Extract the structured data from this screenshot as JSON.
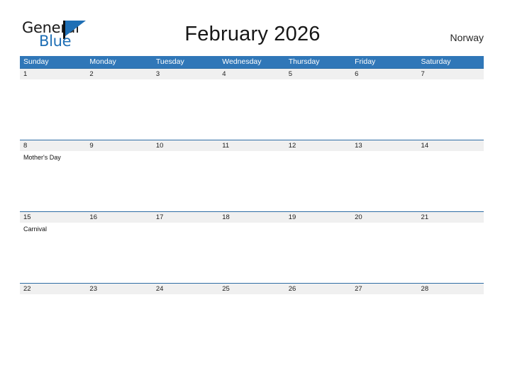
{
  "brand": {
    "name_part1": "General",
    "name_part2": "Blue",
    "flag_icon": "flag-icon",
    "accent_color": "#1f6fb5"
  },
  "header": {
    "title": "February 2026",
    "locale": "Norway"
  },
  "theme": {
    "header_blue": "#3077b8",
    "row_divider_blue": "#2e6da4",
    "date_band_gray": "#f0f0f0",
    "page_background": "#ffffff",
    "text_dark": "#1c1c1c"
  },
  "calendar": {
    "month": "February",
    "year": "2026",
    "weekday_headers": [
      "Sunday",
      "Monday",
      "Tuesday",
      "Wednesday",
      "Thursday",
      "Friday",
      "Saturday"
    ],
    "weeks": [
      {
        "days": [
          {
            "date": "1",
            "events": []
          },
          {
            "date": "2",
            "events": []
          },
          {
            "date": "3",
            "events": []
          },
          {
            "date": "4",
            "events": []
          },
          {
            "date": "5",
            "events": []
          },
          {
            "date": "6",
            "events": []
          },
          {
            "date": "7",
            "events": []
          }
        ]
      },
      {
        "days": [
          {
            "date": "8",
            "events": [
              "Mother's Day"
            ]
          },
          {
            "date": "9",
            "events": []
          },
          {
            "date": "10",
            "events": []
          },
          {
            "date": "11",
            "events": []
          },
          {
            "date": "12",
            "events": []
          },
          {
            "date": "13",
            "events": []
          },
          {
            "date": "14",
            "events": []
          }
        ]
      },
      {
        "days": [
          {
            "date": "15",
            "events": [
              "Carnival"
            ]
          },
          {
            "date": "16",
            "events": []
          },
          {
            "date": "17",
            "events": []
          },
          {
            "date": "18",
            "events": []
          },
          {
            "date": "19",
            "events": []
          },
          {
            "date": "20",
            "events": []
          },
          {
            "date": "21",
            "events": []
          }
        ]
      },
      {
        "days": [
          {
            "date": "22",
            "events": []
          },
          {
            "date": "23",
            "events": []
          },
          {
            "date": "24",
            "events": []
          },
          {
            "date": "25",
            "events": []
          },
          {
            "date": "26",
            "events": []
          },
          {
            "date": "27",
            "events": []
          },
          {
            "date": "28",
            "events": []
          },
          {
            "date": "",
            "events": []
          }
        ]
      }
    ]
  }
}
